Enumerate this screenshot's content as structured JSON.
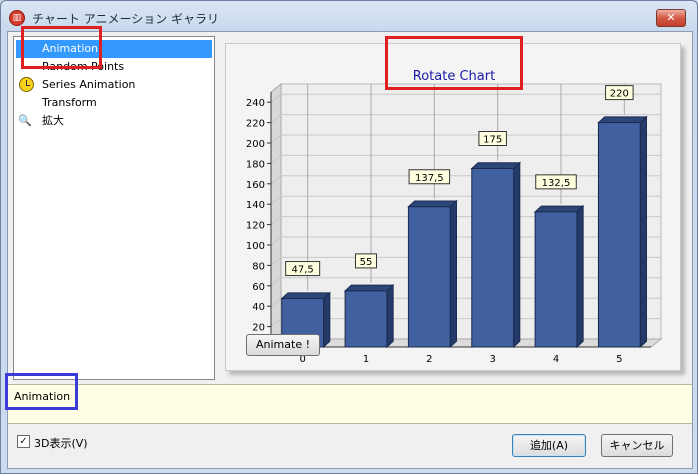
{
  "window": {
    "title": "チャート アニメーション ギャラリ",
    "close_label": "✕"
  },
  "list": {
    "items": [
      {
        "label": "Animation",
        "selected": true,
        "icon": ""
      },
      {
        "label": "Random Points",
        "selected": false,
        "icon": ""
      },
      {
        "label": "Series Animation",
        "selected": false,
        "icon": "clock-icon"
      },
      {
        "label": "Transform",
        "selected": false,
        "icon": ""
      },
      {
        "label": "拡大",
        "selected": false,
        "icon": "zoom-icon"
      }
    ]
  },
  "chart_data": {
    "type": "bar",
    "title": "Rotate Chart",
    "categories": [
      "0",
      "1",
      "2",
      "3",
      "4",
      "5"
    ],
    "values": [
      47.5,
      55,
      137.5,
      175,
      132.5,
      220
    ],
    "value_labels": [
      "47,5",
      "55",
      "137,5",
      "175",
      "132,5",
      "220"
    ],
    "yticks": [
      "20",
      "40",
      "60",
      "80",
      "100",
      "120",
      "140",
      "160",
      "180",
      "200",
      "220",
      "240"
    ],
    "ylim": [
      0,
      250
    ],
    "style": "3d",
    "bar_color": "#4060a0",
    "grid": true
  },
  "chart_panel": {
    "animate_label": "Animate !"
  },
  "description": {
    "text": "Animation"
  },
  "options": {
    "checkbox_label": "3D表示(V)",
    "checkbox_checked": true,
    "check_mark": "✓"
  },
  "buttons": {
    "add_label": "追加(A)",
    "cancel_label": "キャンセル"
  },
  "colors": {
    "annotation_red": "#e02020",
    "annotation_blue": "#3b3bd6",
    "selection": "#3399ff"
  }
}
